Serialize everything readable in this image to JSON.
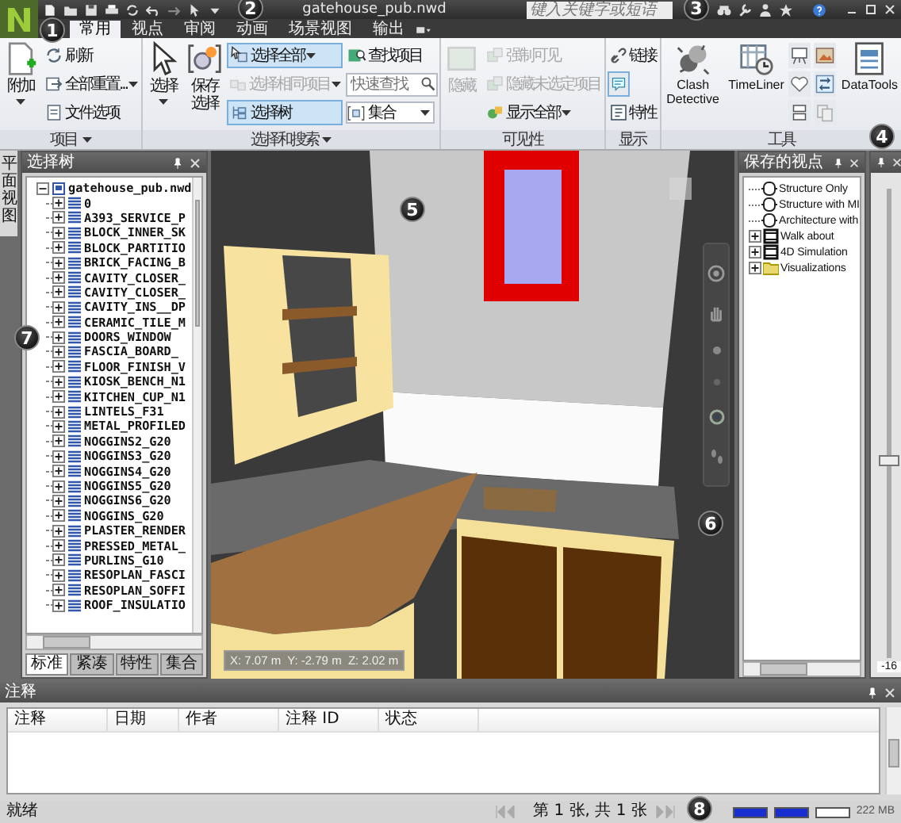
{
  "title_bar": {
    "title": "gatehouse_pub.nwd",
    "search": {
      "placeholder": "键入关键字或短语"
    }
  },
  "ribbon_tabs": [
    {
      "label": "常用",
      "selected": true
    },
    {
      "label": "视点",
      "selected": false
    },
    {
      "label": "审阅",
      "selected": false
    },
    {
      "label": "动画",
      "selected": false
    },
    {
      "label": "场景视图",
      "selected": false
    },
    {
      "label": "输出",
      "selected": false
    }
  ],
  "ribbon_groups": [
    {
      "label": "项目",
      "menu": true,
      "items": [
        {
          "kind": "large",
          "label": "附加",
          "menu": true
        },
        {
          "kind": "small",
          "label": "刷新"
        },
        {
          "kind": "small",
          "label": "全部重置...",
          "menu": true
        },
        {
          "kind": "small",
          "label": "文件选项"
        }
      ]
    },
    {
      "label": "选择和搜索",
      "menu": true,
      "items": [
        {
          "kind": "large",
          "label": "选择",
          "menu": true,
          "on": false,
          "disabled": false
        },
        {
          "kind": "large",
          "label": "保存选择",
          "on": false,
          "disabled": false
        },
        {
          "kind": "small",
          "label": "选择全部",
          "menu": true,
          "on": true,
          "disabled": false
        },
        {
          "kind": "small",
          "label": "选择相同项目",
          "menu": true,
          "on": false,
          "disabled": true
        },
        {
          "kind": "small",
          "label": "选择树",
          "on": true,
          "disabled": false
        },
        {
          "kind": "small",
          "label": "查找项目",
          "on": false,
          "disabled": false
        },
        {
          "kind": "field",
          "placeholder": "快速查找"
        },
        {
          "kind": "dropdown",
          "label": "集合"
        }
      ]
    },
    {
      "label": "可见性",
      "items": [
        {
          "kind": "large",
          "label": "隐藏",
          "disabled": true
        },
        {
          "kind": "small",
          "label": "强制可见",
          "disabled": true
        },
        {
          "kind": "small",
          "label": "隐藏未选定项目",
          "disabled": true
        },
        {
          "kind": "small",
          "label": "显示全部",
          "menu": true,
          "disabled": false
        }
      ]
    },
    {
      "label": "显示",
      "items": [
        {
          "kind": "small",
          "label": "链接",
          "on": false
        },
        {
          "kind": "icon",
          "on": true
        },
        {
          "kind": "small",
          "label": "特性",
          "on": false
        }
      ]
    },
    {
      "label": "工具",
      "items": [
        {
          "kind": "large",
          "label": "Clash Detective"
        },
        {
          "kind": "large",
          "label": "TimeLiner"
        },
        {
          "kind": "icon"
        },
        {
          "kind": "icon"
        },
        {
          "kind": "icon"
        },
        {
          "kind": "icon"
        },
        {
          "kind": "icon"
        },
        {
          "kind": "icon"
        },
        {
          "kind": "large",
          "label": "DataTools"
        }
      ]
    }
  ],
  "side_tab": {
    "label": "平面视图"
  },
  "selection_tree": {
    "title": "选择树",
    "root": {
      "label": "gatehouse_pub.nwd",
      "expanded": true,
      "children": [
        {
          "label": "0",
          "expanded": false
        },
        {
          "label": "A393_SERVICE_P",
          "expanded": false
        },
        {
          "label": "BLOCK_INNER_SK",
          "expanded": false
        },
        {
          "label": "BLOCK_PARTITIO",
          "expanded": false
        },
        {
          "label": "BRICK_FACING_B",
          "expanded": false
        },
        {
          "label": "CAVITY_CLOSER_",
          "expanded": false
        },
        {
          "label": "CAVITY_CLOSER_",
          "expanded": false
        },
        {
          "label": "CAVITY_INS__DP",
          "expanded": false
        },
        {
          "label": "CERAMIC_TILE_M",
          "expanded": false
        },
        {
          "label": "DOORS_WINDOW",
          "expanded": false
        },
        {
          "label": "FASCIA_BOARD_",
          "expanded": false
        },
        {
          "label": "FLOOR_FINISH_V",
          "expanded": false
        },
        {
          "label": "KIOSK_BENCH_N1",
          "expanded": false
        },
        {
          "label": "KITCHEN_CUP_N1",
          "expanded": false
        },
        {
          "label": "LINTELS_F31",
          "expanded": false
        },
        {
          "label": "METAL_PROFILED",
          "expanded": false
        },
        {
          "label": "NOGGINS2_G20",
          "expanded": false
        },
        {
          "label": "NOGGINS3_G20",
          "expanded": false
        },
        {
          "label": "NOGGINS4_G20",
          "expanded": false
        },
        {
          "label": "NOGGINS5_G20",
          "expanded": false
        },
        {
          "label": "NOGGINS6_G20",
          "expanded": false
        },
        {
          "label": "NOGGINS_G20",
          "expanded": false
        },
        {
          "label": "PLASTER_RENDER",
          "expanded": false
        },
        {
          "label": "PRESSED_METAL_",
          "expanded": false
        },
        {
          "label": "PURLINS_G10",
          "expanded": false
        },
        {
          "label": "RESOPLAN_FASCI",
          "expanded": false
        },
        {
          "label": "RESOPLAN_SOFFI",
          "expanded": false
        },
        {
          "label": "ROOF_INSULATIO",
          "expanded": false
        }
      ]
    },
    "tabs": [
      {
        "label": "标准",
        "selected": true
      },
      {
        "label": "紧凑",
        "selected": false
      },
      {
        "label": "特性",
        "selected": false
      },
      {
        "label": "集合",
        "selected": false
      }
    ]
  },
  "viewport": {
    "coordinates": "X: 7.07 m  Y: -2.79 m  Z: 2.02 m"
  },
  "saved_viewpoints": {
    "title": "保存的视点",
    "items": [
      {
        "kind": "viewpoint",
        "label": "Structure Only"
      },
      {
        "kind": "viewpoint",
        "label": "Structure with MI"
      },
      {
        "kind": "viewpoint",
        "label": "Architecture with"
      },
      {
        "kind": "animation",
        "label": "Walk about",
        "expanded": false
      },
      {
        "kind": "animation",
        "label": "4D Simulation",
        "expanded": false
      },
      {
        "kind": "folder",
        "label": "Visualizations",
        "expanded": false
      }
    ]
  },
  "slider": {
    "level": 0.42,
    "reading": "-16"
  },
  "comments": {
    "title": "注释",
    "columns": [
      "注释",
      "日期",
      "作者",
      "注释 ID",
      "状态"
    ]
  },
  "status_bar": {
    "text": "就绪",
    "page": "第 1 张, 共 1 张",
    "meters": [
      {
        "level": 1
      },
      {
        "level": 1
      },
      {
        "level": 0
      }
    ],
    "memory": "222 MB"
  },
  "callouts": [
    {
      "label": "1"
    },
    {
      "label": "2"
    },
    {
      "label": "3"
    },
    {
      "label": "4"
    },
    {
      "label": "5"
    },
    {
      "label": "6"
    },
    {
      "label": "7"
    },
    {
      "label": "8"
    }
  ]
}
